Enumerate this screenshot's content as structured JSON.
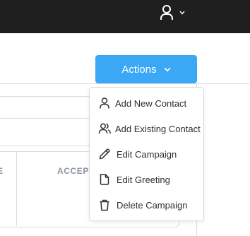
{
  "header": {
    "user_menu": {
      "icon": "user-icon",
      "caret": "chevron-down-icon"
    }
  },
  "background": {
    "table_header_fragments": [
      "E",
      "ACCEP"
    ]
  },
  "actions": {
    "label": "Actions",
    "caret": "chevron-down-icon",
    "color": "#3aa8f5"
  },
  "menu": {
    "items": [
      {
        "label": "Add New Contact",
        "icon": "user-icon"
      },
      {
        "label": "Add Existing Contact",
        "icon": "users-icon"
      },
      {
        "label": "Edit Campaign",
        "icon": "pencil-icon"
      },
      {
        "label": "Edit Greeting",
        "icon": "document-icon"
      },
      {
        "label": "Delete Campaign",
        "icon": "trash-icon"
      }
    ]
  }
}
